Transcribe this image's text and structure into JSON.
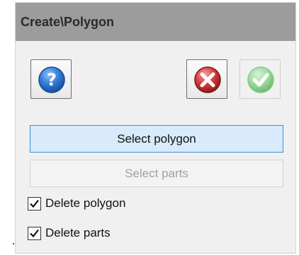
{
  "panel": {
    "title": "Create\\Polygon"
  },
  "toolbar": {
    "help_icon": "help-question-icon",
    "cancel_icon": "cancel-x-icon",
    "ok_icon": "ok-check-icon",
    "colors": {
      "help": "#2f7bd8",
      "cancel": "#d83a3a",
      "ok": "#7fcf7f"
    }
  },
  "buttons": {
    "select_polygon": "Select polygon",
    "select_parts": "Select parts"
  },
  "options": {
    "delete_polygon": {
      "label": "Delete polygon",
      "checked": true
    },
    "delete_parts": {
      "label": "Delete parts",
      "checked": true
    }
  }
}
